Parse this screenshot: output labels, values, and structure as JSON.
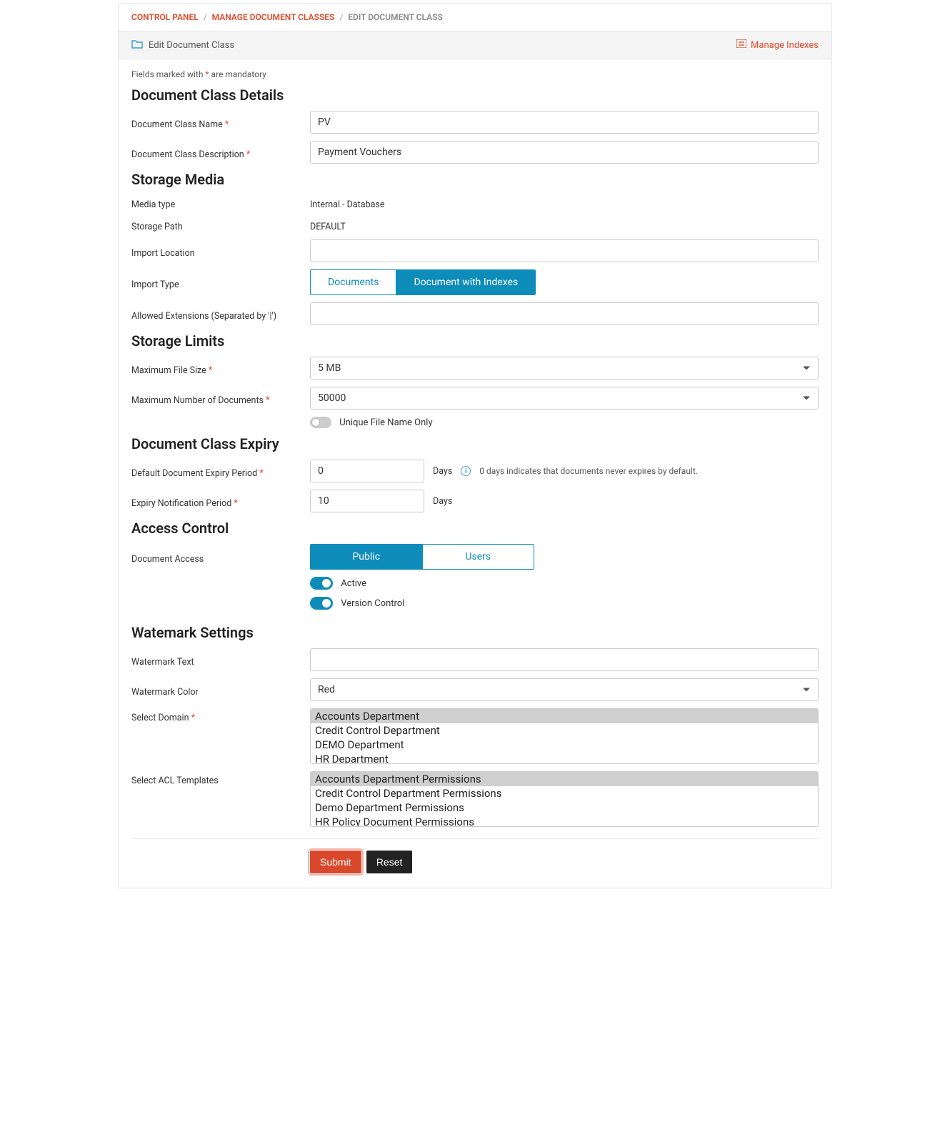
{
  "breadcrumb": {
    "items": [
      {
        "text": "CONTROL PANEL",
        "link": true
      },
      {
        "text": "MANAGE DOCUMENT CLASSES",
        "link": true
      },
      {
        "text": "EDIT DOCUMENT CLASS",
        "link": false
      }
    ]
  },
  "titlebar": {
    "title": "Edit Document Class",
    "manage_indexes": "Manage Indexes"
  },
  "mandatory_note_pre": "Fields marked with ",
  "mandatory_note_post": " are mandatory",
  "mandatory_star": "*",
  "sections": {
    "details": "Document Class Details",
    "storage_media": "Storage Media",
    "storage_limits": "Storage Limits",
    "expiry": "Document Class Expiry",
    "access": "Access Control",
    "watermark": "Watemark Settings"
  },
  "labels": {
    "class_name": "Document Class Name ",
    "class_desc": "Document Class Description ",
    "media_type": "Media type",
    "storage_path": "Storage Path",
    "import_location": "Import Location",
    "import_type": "Import Type",
    "allowed_ext": "Allowed Extensions (Separated by '|')",
    "max_file_size": "Maximum File Size ",
    "max_docs": "Maximum Number of Documents ",
    "unique_filename": "Unique File Name Only",
    "default_expiry": "Default Document Expiry Period ",
    "expiry_notif": "Expiry Notification Period ",
    "doc_access": "Document Access",
    "active": "Active",
    "version_control": "Version Control",
    "watermark_text": "Watermark Text",
    "watermark_color": "Watermark Color",
    "select_domain": "Select Domain ",
    "select_acl": "Select ACL Templates",
    "days": "Days",
    "expiry_help": "0 days indicates that documents never expires by default."
  },
  "values": {
    "class_name": "PV",
    "class_desc": "Payment Vouchers",
    "media_type": "Internal - Database",
    "storage_path": "DEFAULT",
    "import_location": "",
    "import_type_opts": [
      "Documents",
      "Document with Indexes"
    ],
    "import_type_active": 1,
    "allowed_ext": "",
    "max_file_size": "5 MB",
    "max_docs": "50000",
    "unique_filename_on": false,
    "default_expiry": "0",
    "expiry_notif": "10",
    "doc_access_opts": [
      "Public",
      "Users"
    ],
    "doc_access_active": 0,
    "active_on": true,
    "version_control_on": true,
    "watermark_text": "",
    "watermark_color": "Red",
    "domains": [
      {
        "text": "Accounts Department",
        "selected": true
      },
      {
        "text": "Credit Control Department",
        "selected": false
      },
      {
        "text": "DEMO Department",
        "selected": false
      },
      {
        "text": "HR Department",
        "selected": false
      }
    ],
    "acl_templates": [
      {
        "text": "Accounts Department Permissions",
        "selected": true
      },
      {
        "text": "Credit Control Department Permissions",
        "selected": false
      },
      {
        "text": "Demo Department Permissions",
        "selected": false
      },
      {
        "text": "HR Policy Document Permissions",
        "selected": false
      }
    ]
  },
  "buttons": {
    "submit": "Submit",
    "reset": "Reset"
  },
  "icons": {
    "folder": "folder-icon",
    "list": "list-icon",
    "info": "info-icon"
  }
}
